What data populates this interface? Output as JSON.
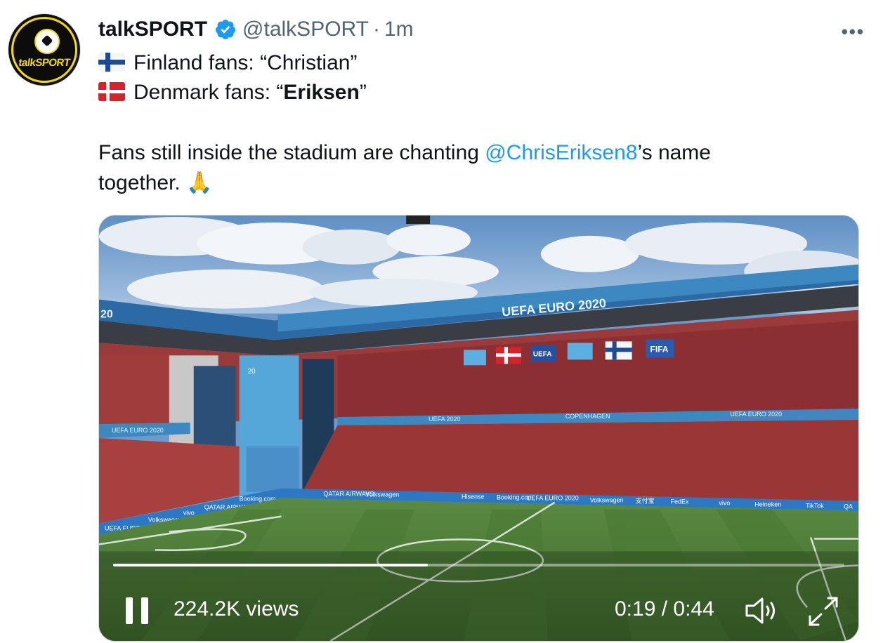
{
  "tweet": {
    "author": {
      "name": "talkSPORT",
      "handle": "@talkSPORT",
      "time": "1m",
      "avatar_text": "talkSPORT",
      "verified": true
    },
    "lines": {
      "finland_prefix": "Finland fans: “Christian”",
      "denmark_prefix": "Denmark fans: “",
      "denmark_bold": "Eriksen",
      "denmark_suffix": "”",
      "body_start": "Fans still inside the stadium are chanting ",
      "mention": "@ChrisEriksen8",
      "body_end": "’s name",
      "body_line2": "together. 🙏"
    },
    "icons": {
      "more": "more-icon",
      "finland_flag": "finland-flag-icon",
      "denmark_flag": "denmark-flag-icon"
    }
  },
  "video": {
    "views": "224.2K views",
    "timecode": "0:19 / 0:44",
    "progress": 0.43,
    "scene_text": {
      "banner": "UEFA EURO 2020",
      "banner_left": "20",
      "flag_label_uefa": "UEFA",
      "flag_label_fifa": "FIFA",
      "tier_left": "UEFA EURO 2020",
      "tier_center": "UEFA 2020",
      "tier_city": "COPENHAGEN",
      "tier_right": "UEFA EURO 2020",
      "ads": [
        "QATAR AIRWAYS",
        "Volkswagen",
        "Hisense",
        "Booking.com",
        "UEFA EURO 2020",
        "Volkswagen",
        "支付宝",
        "FedEx",
        "vivo",
        "Heineken",
        "TikTok",
        "QA"
      ],
      "ads_left": [
        "UEFA EURO 2020",
        "Volkswagen",
        "vivo",
        "QATAR AIRWAYS",
        "Booking.com"
      ]
    },
    "colors": {
      "accent": "#1d9bf0",
      "pitch": "#4f7c3a"
    }
  }
}
